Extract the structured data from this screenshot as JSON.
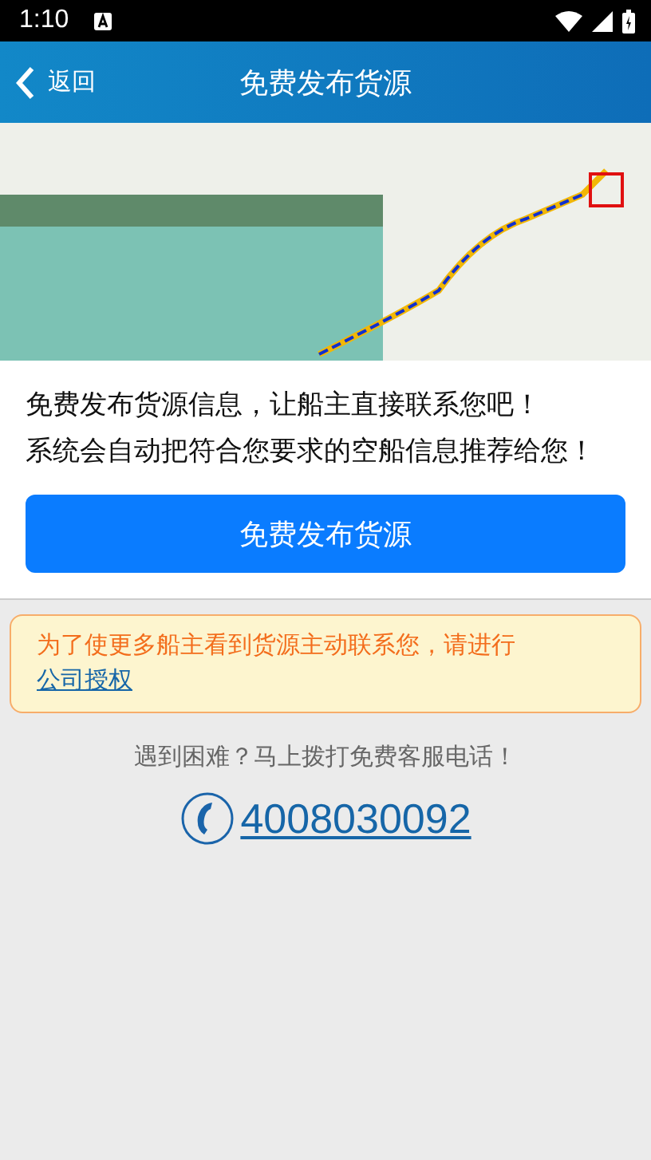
{
  "status_bar": {
    "time": "1:10"
  },
  "nav_bar": {
    "back_label": "返回",
    "title": "免费发布货源"
  },
  "intro": {
    "lines": [
      "免费发布货源信息，让船主直接联系您吧！",
      "系统会自动把符合您要求的空船信息推荐给您！"
    ],
    "button": "免费发布货源"
  },
  "notice": {
    "text": "为了使更多船主看到货源主动联系您，请进行",
    "link": "公司授权"
  },
  "help": {
    "text": "遇到困难？马上拨打免费客服电话！",
    "phone": "4008030092"
  }
}
